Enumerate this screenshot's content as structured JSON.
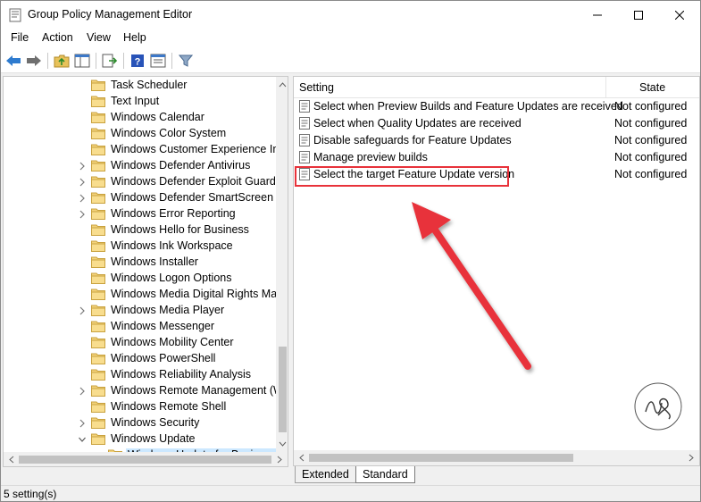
{
  "window": {
    "title": "Group Policy Management Editor"
  },
  "menu": [
    "File",
    "Action",
    "View",
    "Help"
  ],
  "toolbar": {
    "icons": [
      "back-arrow-icon",
      "forward-arrow-icon",
      "up-folder-icon",
      "show-hide-tree-icon",
      "export-list-icon",
      "help-icon",
      "properties-icon",
      "filter-icon"
    ]
  },
  "tree": {
    "items": [
      {
        "label": "Task Scheduler",
        "expander": ""
      },
      {
        "label": "Text Input",
        "expander": ""
      },
      {
        "label": "Windows Calendar",
        "expander": ""
      },
      {
        "label": "Windows Color System",
        "expander": ""
      },
      {
        "label": "Windows Customer Experience Imp",
        "expander": ""
      },
      {
        "label": "Windows Defender Antivirus",
        "expander": ">"
      },
      {
        "label": "Windows Defender Exploit Guard",
        "expander": ">"
      },
      {
        "label": "Windows Defender SmartScreen",
        "expander": ">"
      },
      {
        "label": "Windows Error Reporting",
        "expander": ">"
      },
      {
        "label": "Windows Hello for Business",
        "expander": ""
      },
      {
        "label": "Windows Ink Workspace",
        "expander": ""
      },
      {
        "label": "Windows Installer",
        "expander": ""
      },
      {
        "label": "Windows Logon Options",
        "expander": ""
      },
      {
        "label": "Windows Media Digital Rights Mar",
        "expander": ""
      },
      {
        "label": "Windows Media Player",
        "expander": ">"
      },
      {
        "label": "Windows Messenger",
        "expander": ""
      },
      {
        "label": "Windows Mobility Center",
        "expander": ""
      },
      {
        "label": "Windows PowerShell",
        "expander": ""
      },
      {
        "label": "Windows Reliability Analysis",
        "expander": ""
      },
      {
        "label": "Windows Remote Management (W",
        "expander": ">"
      },
      {
        "label": "Windows Remote Shell",
        "expander": ""
      },
      {
        "label": "Windows Security",
        "expander": ">"
      },
      {
        "label": "Windows Update",
        "expander": "v"
      },
      {
        "label": "Windows Update for Business",
        "expander": "",
        "child": true,
        "selected": true
      }
    ]
  },
  "list": {
    "columns": {
      "setting": "Setting",
      "state": "State"
    },
    "rows": [
      {
        "name": "Select when Preview Builds and Feature Updates are received",
        "state": "Not configured"
      },
      {
        "name": "Select when Quality Updates are received",
        "state": "Not configured"
      },
      {
        "name": "Disable safeguards for Feature Updates",
        "state": "Not configured"
      },
      {
        "name": "Manage preview builds",
        "state": "Not configured"
      },
      {
        "name": "Select the target Feature Update version",
        "state": "Not configured",
        "highlighted": true
      }
    ]
  },
  "tabs": {
    "extended": "Extended",
    "standard": "Standard",
    "active": "Standard"
  },
  "status": {
    "text": "5 setting(s)"
  },
  "colors": {
    "highlight": "#e8323a",
    "arrow": "#e8323a",
    "selection": "#cce8ff"
  }
}
